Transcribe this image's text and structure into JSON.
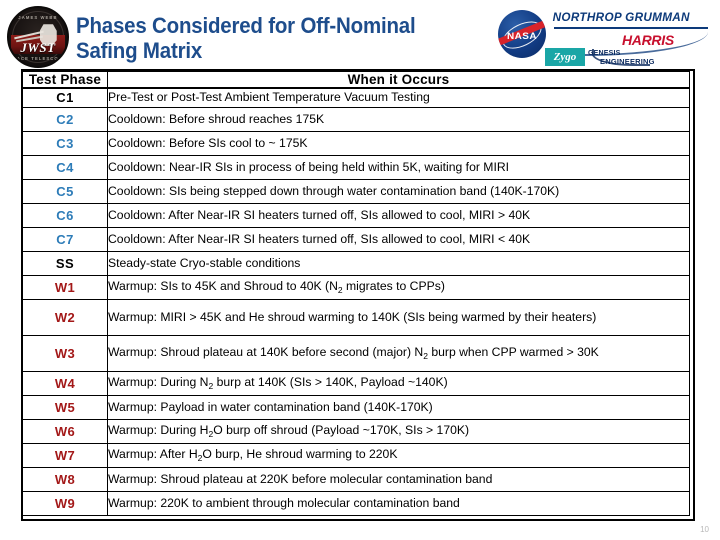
{
  "slide": {
    "title_line1": "Phases Considered for Off-Nominal",
    "title_line2": "Safing Matrix",
    "page_number": "10",
    "colors": {
      "title_blue": "#1e4d8c",
      "phase_blue": "#2d7cb8",
      "phase_red": "#a31818",
      "phase_black": "#000000",
      "nasa_blue": "#123c84",
      "harris_red": "#c8102e",
      "zygo_teal": "#1aa6a6",
      "northrop_blue": "#0d3a7a"
    }
  },
  "logos": {
    "jwst": {
      "name": "jwst-mission-patch",
      "wordmark": "JWST",
      "arc_top": "JAMES WEBB",
      "arc_bottom": "SPACE TELESCOPE"
    },
    "nasa": {
      "name": "nasa-meatball-logo",
      "wordmark": "NASA"
    },
    "northrop": {
      "name": "northrop-grumman-logo",
      "wordmark": "NORTHROP GRUMMAN"
    },
    "harris": {
      "name": "harris-logo",
      "wordmark": "HARRIS"
    },
    "zygo": {
      "name": "zygo-logo",
      "wordmark": "Zygo"
    },
    "genesis": {
      "name": "genesis-engineering-logo",
      "wordmark_line1": "GENESIS",
      "wordmark_line2": "ENGINEERING"
    }
  },
  "table": {
    "headers": [
      "Test Phase",
      "When it Occurs"
    ],
    "rows": [
      {
        "phase": "C1",
        "color": "black",
        "desc": "Pre-Test or Post-Test Ambient Temperature Vacuum Testing",
        "lines": 1
      },
      {
        "phase": "C2",
        "color": "blue",
        "desc": "Cooldown: Before shroud reaches 175K",
        "lines": 1
      },
      {
        "phase": "C3",
        "color": "blue",
        "desc": "Cooldown: Before SIs cool to ~ 175K",
        "lines": 1
      },
      {
        "phase": "C4",
        "color": "blue",
        "desc": "Cooldown: Near-IR SIs in process of being held within 5K, waiting for MIRI",
        "lines": 1
      },
      {
        "phase": "C5",
        "color": "blue",
        "desc": "Cooldown: SIs being stepped down through water contamination band (140K-170K)",
        "lines": 1
      },
      {
        "phase": "C6",
        "color": "blue",
        "desc": "Cooldown: After Near-IR SI heaters turned off, SIs allowed to cool, MIRI > 40K",
        "lines": 1
      },
      {
        "phase": "C7",
        "color": "blue",
        "desc": "Cooldown: After Near-IR SI heaters turned off, SIs allowed to cool, MIRI < 40K",
        "lines": 1
      },
      {
        "phase": "SS",
        "color": "black",
        "desc": "Steady-state Cryo-stable conditions",
        "lines": 1
      },
      {
        "phase": "W1",
        "color": "red",
        "desc_html": "Warmup: SIs to 45K and Shroud to 40K (N<sub>2</sub> migrates to CPPs)",
        "desc": "Warmup: SIs to 45K and Shroud to 40K (N2 migrates to CPPs)",
        "lines": 1
      },
      {
        "phase": "W2",
        "color": "red",
        "desc_html": "Warmup: MIRI > 45K and He shroud warming to 140K (SIs being warmed by their heaters)",
        "desc": "Warmup: MIRI > 45K and He shroud warming to 140K (SIs being warmed by their heaters)",
        "lines": 2
      },
      {
        "phase": "W3",
        "color": "red",
        "desc_html": "Warmup: Shroud plateau at 140K before second (major) N<sub>2</sub> burp when CPP warmed > 30K",
        "desc": "Warmup: Shroud plateau at 140K before second (major) N2 burp when CPP warmed > 30K",
        "lines": 2
      },
      {
        "phase": "W4",
        "color": "red",
        "desc_html": "Warmup: During N<sub>2</sub> burp at 140K (SIs > 140K, Payload ~140K)",
        "desc": "Warmup: During N2 burp at 140K (SIs > 140K, Payload ~140K)",
        "lines": 1
      },
      {
        "phase": "W5",
        "color": "red",
        "desc": "Warmup: Payload in water contamination band (140K-170K)",
        "lines": 1
      },
      {
        "phase": "W6",
        "color": "red",
        "desc_html": "Warmup: During H<sub>2</sub>O burp off shroud (Payload ~170K, SIs > 170K)",
        "desc": "Warmup: During H2O burp off shroud (Payload ~170K, SIs > 170K)",
        "lines": 1
      },
      {
        "phase": "W7",
        "color": "red",
        "desc_html": "Warmup: After H<sub>2</sub>O burp, He shroud warming to 220K",
        "desc": "Warmup: After H2O burp, He shroud warming to 220K",
        "lines": 1
      },
      {
        "phase": "W8",
        "color": "red",
        "desc": "Warmup: Shroud plateau at 220K before molecular contamination band",
        "lines": 1
      },
      {
        "phase": "W9",
        "color": "red",
        "desc": "Warmup: 220K to ambient through molecular contamination band",
        "lines": 1
      }
    ]
  }
}
